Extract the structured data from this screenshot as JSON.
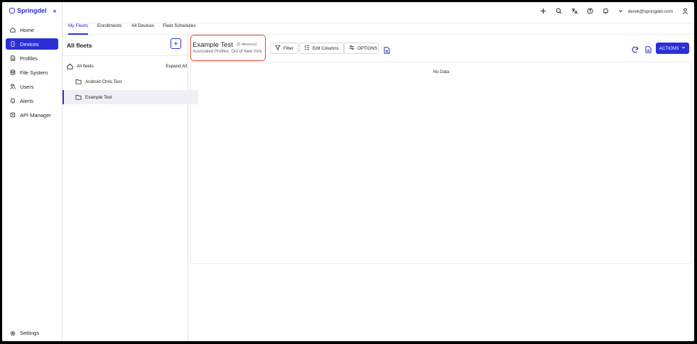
{
  "app": {
    "logo_text": "Springdel",
    "collapse_symbol": "«"
  },
  "sidebar": {
    "items": [
      {
        "label": "Home",
        "icon": "home-icon"
      },
      {
        "label": "Devices",
        "icon": "device-icon",
        "active": true
      },
      {
        "label": "Profiles",
        "icon": "document-icon"
      },
      {
        "label": "File System",
        "icon": "database-icon"
      },
      {
        "label": "Users",
        "icon": "users-icon"
      },
      {
        "label": "Alerts",
        "icon": "bell-icon"
      },
      {
        "label": "API Manager",
        "icon": "api-icon"
      }
    ],
    "settings_label": "Settings"
  },
  "topbar": {
    "user_email": "derek@springdel.com"
  },
  "tabs": [
    {
      "label": "My Fleets",
      "active": true
    },
    {
      "label": "Enrollments"
    },
    {
      "label": "All Devices"
    },
    {
      "label": "Fleet Schedules"
    }
  ],
  "fleet_panel": {
    "title": "All fleets",
    "add_symbol": "+",
    "root_label": "All fleets",
    "expand_all": "Expand All",
    "fleets": [
      {
        "label": "Android Chris Test"
      },
      {
        "label": "Example Test",
        "selected": true
      }
    ]
  },
  "main": {
    "fleet_name": "Example Test",
    "device_count": "(0 devices)",
    "associated_profiles": "Associated Profiles: Out of New York",
    "filter_label": "Filter",
    "edit_columns_label": "Edit Columns",
    "options_label": "OPTIONS",
    "actions_label": "ACTIONS",
    "no_data": "No Data"
  },
  "colors": {
    "accent": "#2b2fd6",
    "highlight_border": "#e04a2a"
  }
}
